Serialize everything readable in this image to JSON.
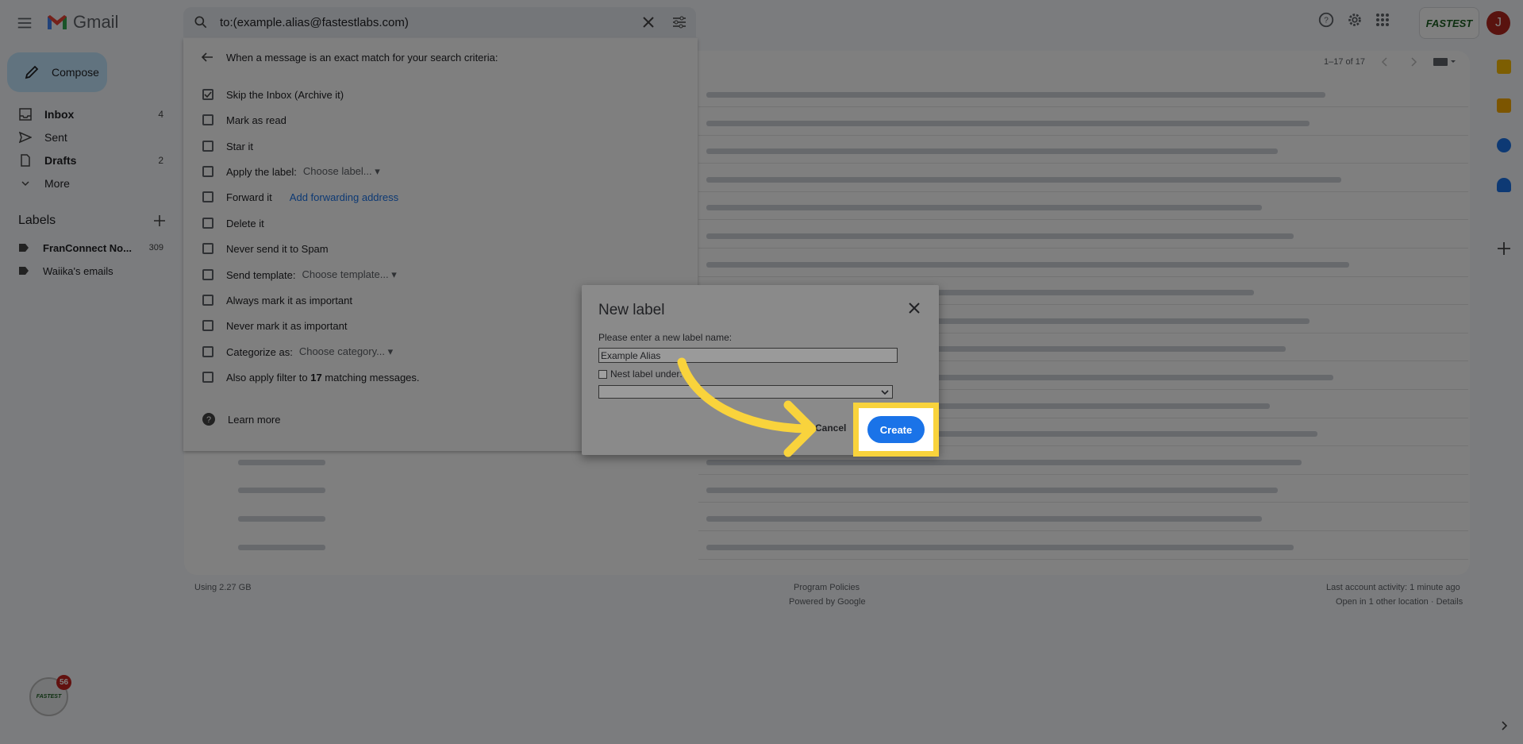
{
  "app": {
    "name": "Gmail"
  },
  "search": {
    "query": "to:(example.alias@fastestlabs.com)"
  },
  "header": {
    "avatar_initial": "J",
    "brand_logo_text": "FASTEST"
  },
  "sidebar": {
    "compose_label": "Compose",
    "items": [
      {
        "label": "Inbox",
        "count": "4",
        "icon": "inbox-icon"
      },
      {
        "label": "Sent",
        "count": "",
        "icon": "send-icon"
      },
      {
        "label": "Drafts",
        "count": "2",
        "icon": "draft-icon"
      },
      {
        "label": "More",
        "count": "",
        "icon": "chevron-down-icon"
      }
    ],
    "labels_title": "Labels",
    "labels": [
      {
        "label": "FranConnect No...",
        "count": "309"
      },
      {
        "label": "Waiika's emails",
        "count": ""
      }
    ]
  },
  "pager": {
    "text": "1–17 of 17"
  },
  "filter_panel": {
    "heading": "When a message is an exact match for your search criteria:",
    "options": [
      {
        "label": "Skip the Inbox (Archive it)",
        "checked": true
      },
      {
        "label": "Mark as read"
      },
      {
        "label": "Star it"
      },
      {
        "label": "Apply the label:",
        "dropdown": "Choose label..."
      },
      {
        "label": "Forward it",
        "link": "Add forwarding address"
      },
      {
        "label": "Delete it"
      },
      {
        "label": "Never send it to Spam"
      },
      {
        "label": "Send template:",
        "dropdown": "Choose template..."
      },
      {
        "label": "Always mark it as important"
      },
      {
        "label": "Never mark it as important"
      },
      {
        "label": "Categorize as:",
        "dropdown": "Choose category..."
      },
      {
        "label_pre": "Also apply filter to ",
        "count": "17",
        "label_post": " matching messages."
      }
    ],
    "learn_more": "Learn more"
  },
  "footer": {
    "storage": "Using 2.27 GB",
    "policies": "Program Policies",
    "powered": "Powered by Google",
    "activity": "Last account activity: 1 minute ago",
    "location": "Open in 1 other location · Details"
  },
  "dialog": {
    "title": "New label",
    "prompt": "Please enter a new label name:",
    "name_value": "Example Alias",
    "nest_label": "Nest label under:",
    "cancel": "Cancel",
    "create": "Create"
  },
  "notification_badge": {
    "count": "56",
    "text": "FASTEST"
  },
  "colors": {
    "accent": "#1a73e8",
    "highlight": "#f9d33c",
    "compose_bg": "#c2e7ff"
  }
}
